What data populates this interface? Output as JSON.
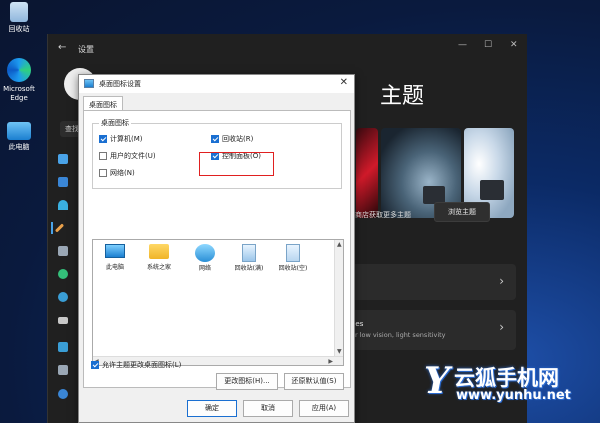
{
  "desktop": {
    "icons": [
      {
        "label": "回收站",
        "icon": "recycle-bin-icon"
      },
      {
        "label": "Microsoft Edge",
        "icon": "edge-icon"
      },
      {
        "label": "此电脑",
        "icon": "computer-icon"
      }
    ]
  },
  "settings": {
    "title": "设置",
    "back": "←",
    "min": "—",
    "max": "☐",
    "close": "✕",
    "search_partial": "查找",
    "heading_partial": "主题",
    "get_more_partial": "软商店获取更多主题",
    "browse_button": "浏览主题",
    "row1_chevron": "›",
    "row2_sub_partial": "nes",
    "row2_desc_partial": "or low vision, light sensitivity",
    "row2_chevron": "›"
  },
  "dialog": {
    "title": "桌面图标设置",
    "close": "✕",
    "tab_label": "桌面图标",
    "group_label": "桌面图标",
    "checkboxes": [
      {
        "label": "计算机(M)",
        "checked": true
      },
      {
        "label": "回收站(R)",
        "checked": true
      },
      {
        "label": "用户的文件(U)",
        "checked": false
      },
      {
        "label": "控制面板(O)",
        "checked": true
      },
      {
        "label": "网络(N)",
        "checked": false
      }
    ],
    "icons": [
      {
        "label": "此电脑",
        "icon": "computer-icon"
      },
      {
        "label": "系统之家",
        "icon": "folder-icon"
      },
      {
        "label": "网络",
        "icon": "network-icon"
      },
      {
        "label": "回收站(满)",
        "icon": "recycle-bin-full-icon"
      },
      {
        "label": "回收站(空)",
        "icon": "recycle-bin-empty-icon"
      }
    ],
    "change_icon_button": "更改图标(H)...",
    "restore_default_button": "还原默认值(S)",
    "allow_themes_label": "允许主题更改桌面图标(L)",
    "allow_themes_checked": true,
    "ok_button": "确定",
    "cancel_button": "取消",
    "apply_button": "应用(A)"
  },
  "watermark": {
    "letter": "Y",
    "name": "云狐手机网",
    "url": "www.yunhu.net"
  },
  "colors": {
    "accent": "#1a6fd1",
    "highlight": "#e02020",
    "settings_bg": "#202020"
  }
}
